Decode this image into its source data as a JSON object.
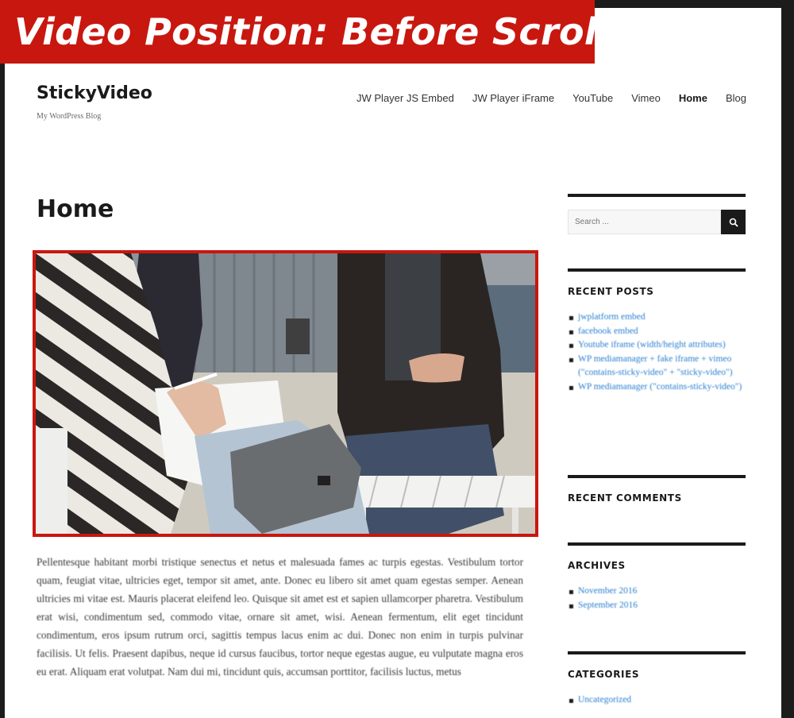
{
  "banner": {
    "title": "Video Position: Before Scroll"
  },
  "site": {
    "title": "StickyVideo",
    "tagline": "My WordPress Blog"
  },
  "nav": {
    "items": [
      {
        "label": "JW Player JS Embed",
        "active": false
      },
      {
        "label": "JW Player iFrame",
        "active": false
      },
      {
        "label": "YouTube",
        "active": false
      },
      {
        "label": "Vimeo",
        "active": false
      },
      {
        "label": "Home",
        "active": true
      },
      {
        "label": "Blog",
        "active": false
      }
    ]
  },
  "main": {
    "heading": "Home",
    "body": "Pellentesque habitant morbi tristique senectus et netus et malesuada fames ac turpis egestas. Vestibulum tortor quam, feugiat vitae, ultricies eget, tempor sit amet, ante. Donec eu libero sit amet quam egestas semper. Aenean ultricies mi vitae est. Mauris placerat eleifend leo. Quisque sit amet est et sapien ullamcorper pharetra. Vestibulum erat wisi, condimentum sed, commodo vitae, ornare sit amet, wisi. Aenean fermentum, elit eget tincidunt condimentum, eros ipsum rutrum orci, sagittis tempus lacus enim ac dui. Donec non enim in turpis pulvinar facilisis. Ut felis. Praesent dapibus, neque id cursus faucibus, tortor neque egestas augue, eu vulputate magna eros eu erat. Aliquam erat volutpat. Nam dui mi, tincidunt quis, accumsan porttitor, facilisis luctus, metus"
  },
  "sidebar": {
    "search": {
      "placeholder": "Search ..."
    },
    "recent_posts": {
      "title": "RECENT POSTS",
      "items": [
        "jwplatform embed",
        "facebook embed",
        "Youtube iframe (width/height attributes)",
        "WP mediamanager + fake iframe + vimeo (\"contains-sticky-video\" + \"sticky-video\")",
        "WP mediamanager (\"contains-sticky-video\")"
      ]
    },
    "recent_comments": {
      "title": "RECENT COMMENTS"
    },
    "archives": {
      "title": "ARCHIVES",
      "items": [
        "November 2016",
        "September 2016"
      ]
    },
    "categories": {
      "title": "CATEGORIES",
      "items": [
        "Uncategorized"
      ]
    }
  },
  "colors": {
    "banner": "#c8170f",
    "video_border": "#c8170f",
    "link": "#2a7fd0",
    "text": "#1a1a1a"
  }
}
